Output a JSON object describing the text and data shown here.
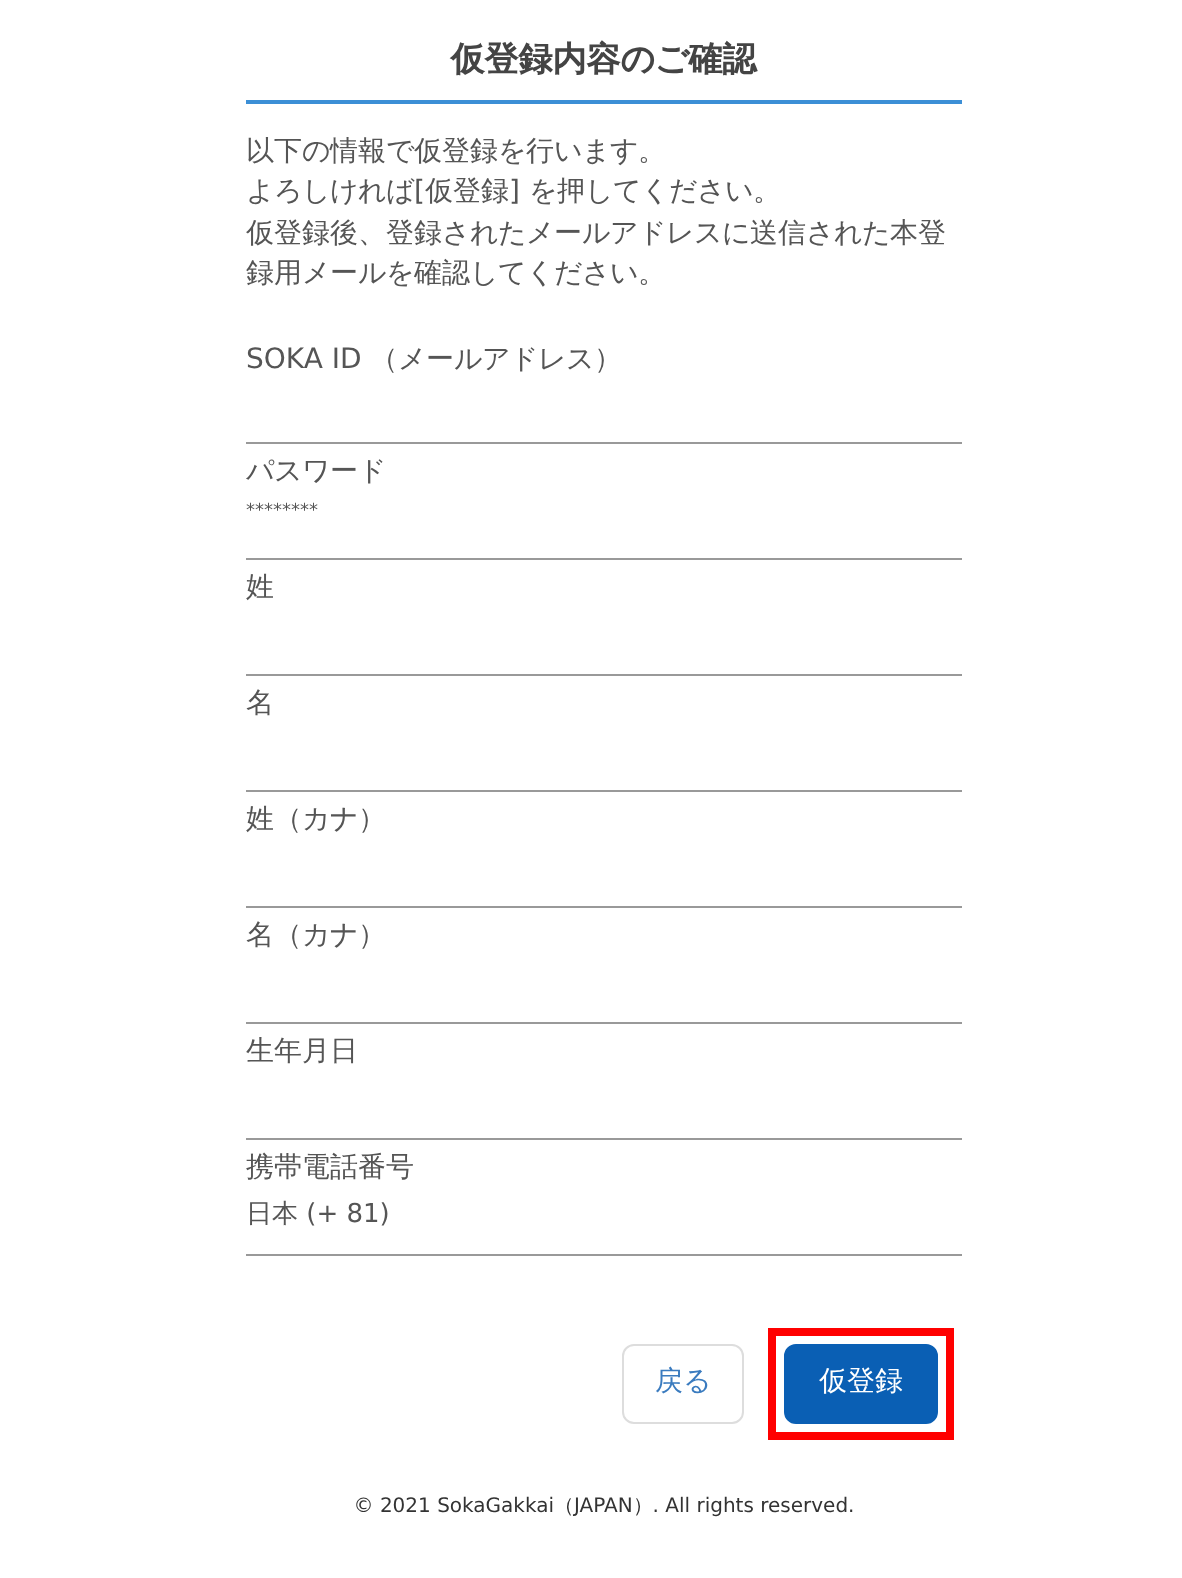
{
  "title": "仮登録内容のご確認",
  "intro": [
    "以下の情報で仮登録を行います。",
    "よろしければ[仮登録] を押してください。",
    "仮登録後、登録されたメールアドレスに送信された本登録用メールを確認してください。"
  ],
  "fields": [
    {
      "label": "SOKA ID （メールアドレス）"
    },
    {
      "label": "パスワード",
      "value": "********",
      "kind": "masked"
    },
    {
      "label": "姓"
    },
    {
      "label": "名"
    },
    {
      "label": "姓（カナ）"
    },
    {
      "label": "名（カナ）"
    },
    {
      "label": "生年月日"
    },
    {
      "label": "携帯電話番号",
      "value": "日本 (+ 81)",
      "kind": "text"
    }
  ],
  "buttons": [
    {
      "label": "戻る",
      "kind": "secondary",
      "highlighted": false
    },
    {
      "label": "仮登録",
      "kind": "primary",
      "highlighted": true
    }
  ],
  "footer": "© 2021 SokaGakkai（JAPAN）. All rights reserved."
}
